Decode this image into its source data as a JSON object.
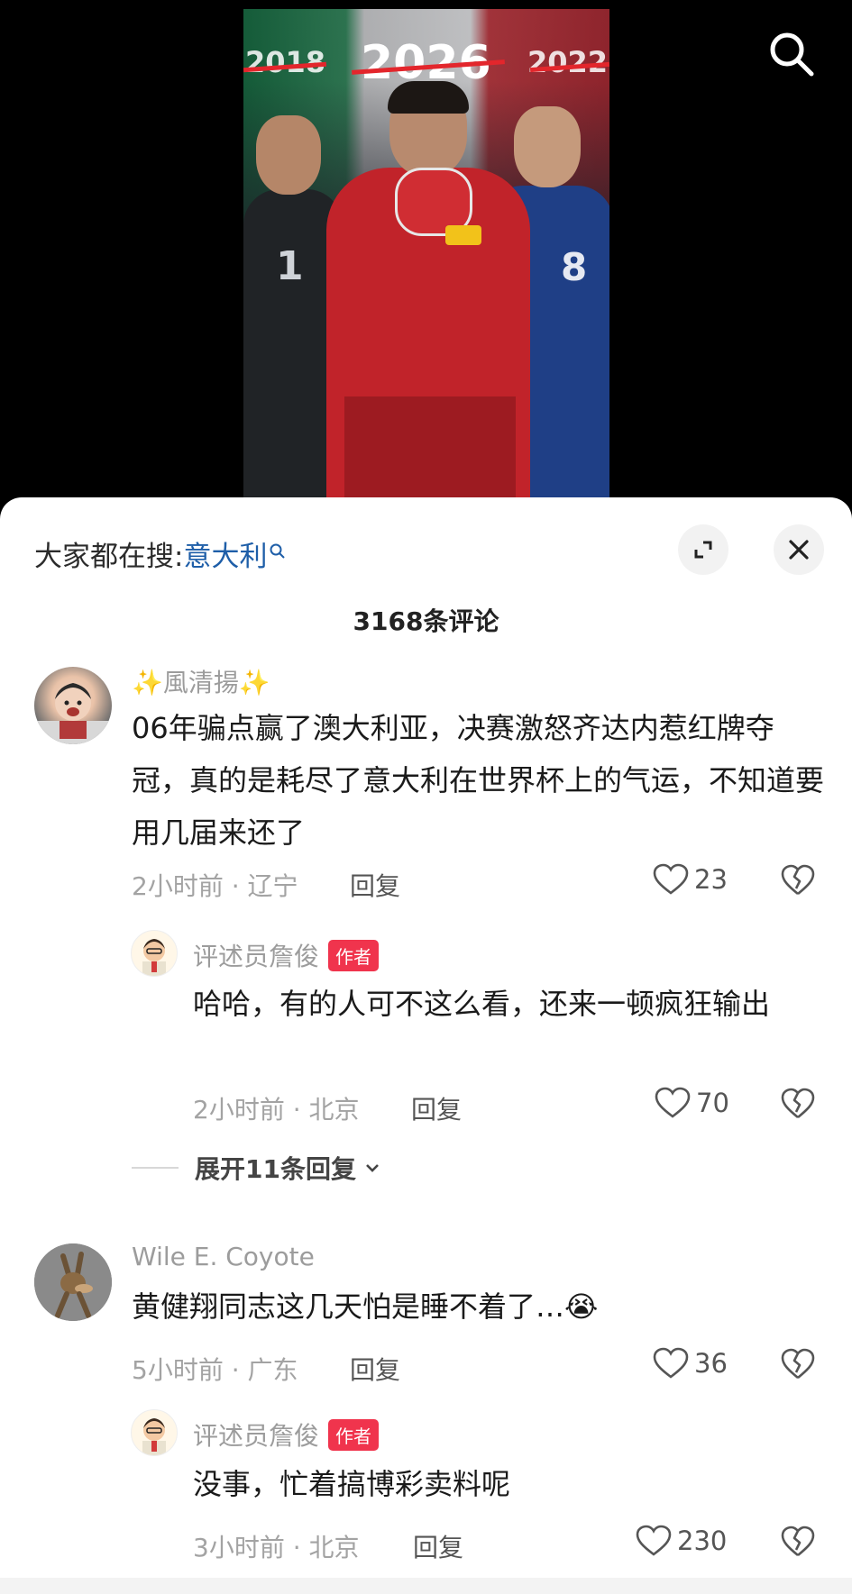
{
  "video": {
    "years": {
      "left": "2018",
      "middle": "2026",
      "right": "2022"
    },
    "jersey_numbers": {
      "left": "1",
      "right": "8"
    }
  },
  "sheet": {
    "suggest_prefix": "大家都在搜:",
    "suggest_keyword": "意大利",
    "comment_count": "3168条评论"
  },
  "comments": [
    {
      "username": "✨風清揚✨",
      "text": "06年骗点赢了澳大利亚，决赛激怒齐达内惹红牌夺冠，真的是耗尽了意大利在世界杯上的气运，不知道要用几届来还了",
      "meta": "2小时前 · 辽宁",
      "reply_label": "回复",
      "likes": "23",
      "replies": [
        {
          "username": "评述员詹俊",
          "badge": "作者",
          "text": "哈哈，有的人可不这么看，还来一顿疯狂输出",
          "meta": "2小时前 · 北京",
          "reply_label": "回复",
          "likes": "70"
        }
      ],
      "expand_label": "展开11条回复"
    },
    {
      "username": "Wile E. Coyote",
      "text": "黄健翔同志这几天怕是睡不着了…😭",
      "meta": "5小时前 · 广东",
      "reply_label": "回复",
      "likes": "36",
      "replies": [
        {
          "username": "评述员詹俊",
          "badge": "作者",
          "text": "没事，忙着搞博彩卖料呢",
          "meta": "3小时前 · 北京",
          "reply_label": "回复",
          "likes": "230"
        }
      ]
    }
  ],
  "icons": {
    "search": "search-icon",
    "expand": "expand-icon",
    "close": "close-icon",
    "like": "heart-icon",
    "dislike": "broken-heart-icon",
    "chevron": "chevron-down-icon"
  },
  "colors": {
    "keyword_link": "#1e5ea8",
    "author_badge": "#f0344d",
    "strike": "#e3262c"
  }
}
